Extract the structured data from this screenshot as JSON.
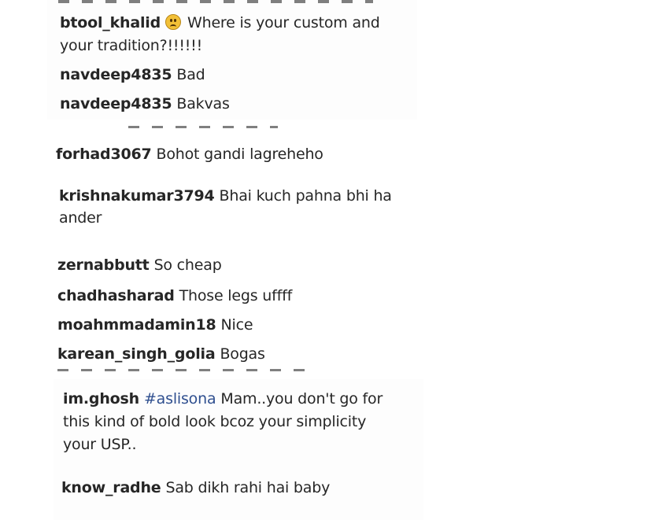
{
  "comments_top": [
    {
      "user": "btool_khalid",
      "emoji": "worried-face-icon",
      "text_line1": "Where is your custom and",
      "text_line2": "your tradition?!!!!!!"
    },
    {
      "user": "navdeep4835",
      "text": "Bad"
    },
    {
      "user": "navdeep4835",
      "text": "Bakvas"
    }
  ],
  "comments_middle": [
    {
      "user": "forhad3067",
      "text": "Bohot gandi lagreheho"
    },
    {
      "user": "krishnakumar3794",
      "text_line1": "Bhai kuch pahna bhi ha",
      "text_line2": "ander"
    },
    {
      "user": "zernabbutt",
      "text": "So cheap"
    },
    {
      "user": "chadhasharad",
      "text": "Those legs uffff"
    },
    {
      "user": "moahmmadamin18",
      "text": "Nice"
    },
    {
      "user": "karean_singh_golia",
      "text": "Bogas"
    }
  ],
  "comments_bottom": [
    {
      "user": "im.ghosh",
      "hashtag": "#aslisona",
      "text_line1": "Mam..you don't go for",
      "text_line2": "this kind of bold look bcoz your simplicity",
      "text_line3": "your USP.."
    },
    {
      "user": "know_radhe",
      "text": "Sab dikh rahi hai baby"
    }
  ]
}
